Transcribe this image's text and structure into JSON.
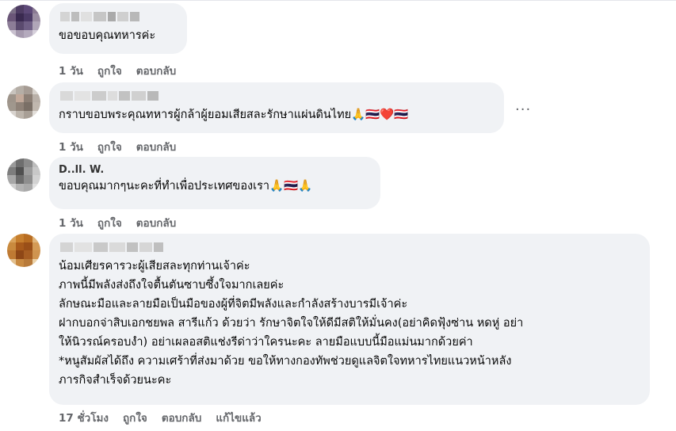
{
  "comments": [
    {
      "text": "ขอขอบคุณทหารค่ะ",
      "time": "1 วัน",
      "like": "ถูกใจ",
      "reply": "ตอบกลับ"
    },
    {
      "text": "กราบขอบพระคุณทหารผู้กล้าผู้ยอมเสียสละรักษาแผ่นดินไทย🙏🇹🇭❤️🇹🇭",
      "time": "1 วัน",
      "like": "ถูกใจ",
      "reply": "ตอบกลับ",
      "more_icon": "···"
    },
    {
      "name_visible": "D..ll. W.",
      "text": "ขอบคุณมากๆนะคะที่ทำเพื่อประเทศของเรา🙏🇹🇭🙏",
      "time": "1 วัน",
      "like": "ถูกใจ",
      "reply": "ตอบกลับ"
    },
    {
      "text": "น้อมเศียรคารวะผู้เสียสละทุกท่านเจ้าค่ะ\nภาพนี้มีพลังส่งถึงใจตื้นตันซาบซึ้งใจมากเลยค่ะ\nลักษณะมือและลายมือเป็นมือของผู้ที่จิตมีพลังและกำลังสร้างบารมีเจ้าค่ะ\nฝากบอกจ่าสิบเอกชยพล สารีแก้ว ด้วยว่า รักษาจิตใจให้ดีมีสติให้มั่นคง(อย่าคิดฟุ้งซ่าน หดหู่ อย่า\nให้นิวรณ์ครอบงำ) อย่าเผลอสติแช่งรีด่าว่าใครนะคะ ลายมือแบบนี้มือแม่นมากด้วยค่า\n*หนูสัมผัสได้ถึง ความเศร้าที่ส่งมาด้วย ขอให้ทางกองทัพช่วยดูแลจิตใจทหารไทยแนวหน้าหลัง\nภารกิจสำเร็จด้วยนะคะ",
      "time": "17 ชั่วโมง",
      "like": "ถูกใจ",
      "reply": "ตอบกลับ",
      "edited": "แก้ไขแล้ว"
    }
  ]
}
